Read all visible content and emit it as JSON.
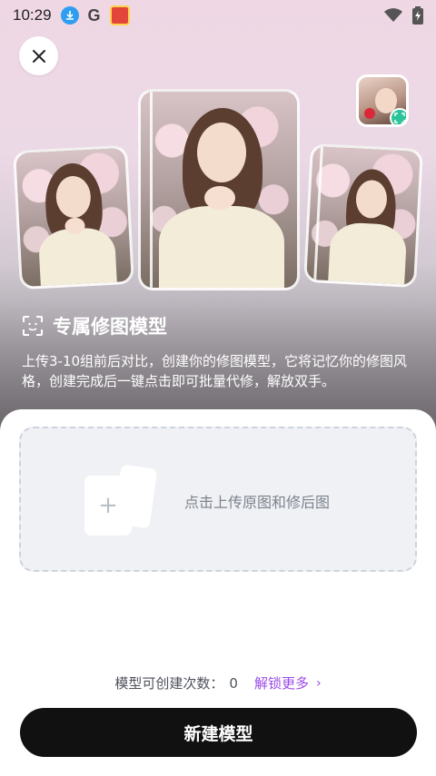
{
  "status_bar": {
    "time": "10:29",
    "icons": [
      "download-icon",
      "google-icon",
      "app-notification-icon"
    ],
    "right_icons": [
      "wifi-icon",
      "battery-charging-icon"
    ]
  },
  "header": {
    "close_icon": "close-icon",
    "profile_thumb_badge_icon": "scan-face-icon"
  },
  "feature": {
    "icon": "face-scan-icon",
    "title": "专属修图模型",
    "description": "上传3-10组前后对比，创建你的修图模型，它将记忆你的修图风格，创建完成后一键点击即可批量代修，解放双手。"
  },
  "upload": {
    "icon": "plus-icon",
    "plus_glyph": "+",
    "label": "点击上传原图和修后图"
  },
  "quota": {
    "label": "模型可创建次数：",
    "value": "0",
    "unlock_label": "解锁更多",
    "unlock_chevron": "›"
  },
  "create_button": {
    "label": "新建模型"
  },
  "colors": {
    "accent": "#9a4be8",
    "button_bg": "#111111",
    "badge": "#2cc39a"
  }
}
